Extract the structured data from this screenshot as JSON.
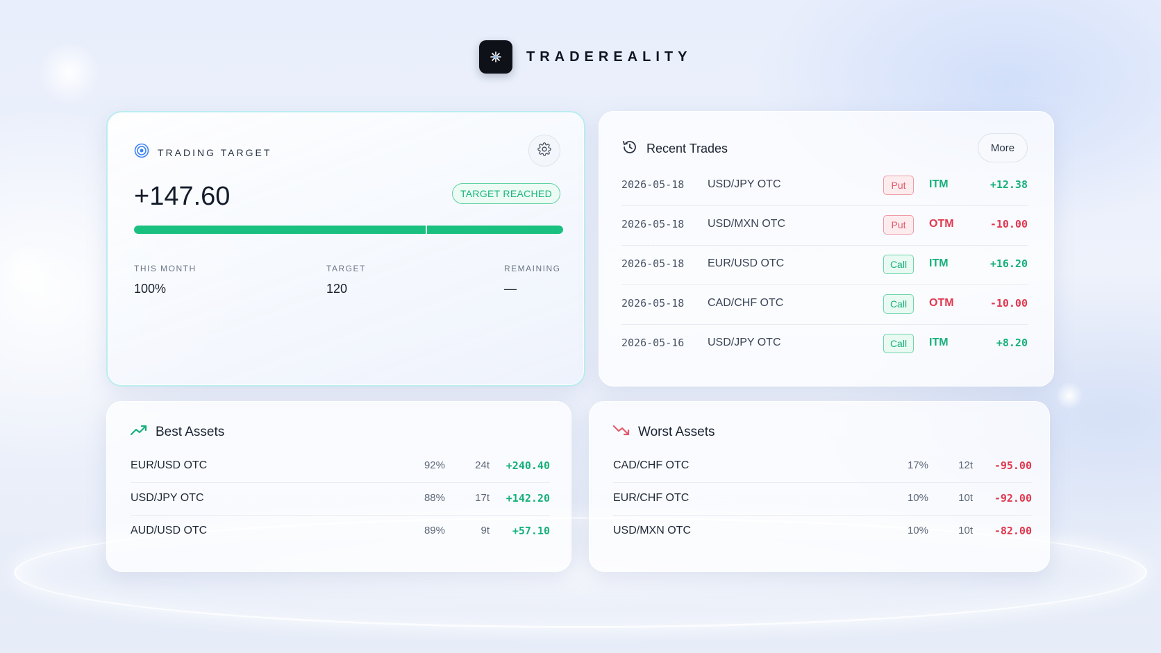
{
  "brand": {
    "name": "TRADEREALITY",
    "logo_icon": "spark-icon"
  },
  "colors": {
    "accent_green": "#19c07f",
    "loss_red": "#e0384f",
    "badge_green": "#19b57a"
  },
  "target": {
    "title": "TRADING TARGET",
    "value": "+147.60",
    "badge": "TARGET REACHED",
    "progress": 1.0,
    "stats": [
      {
        "label": "THIS MONTH",
        "value": "100%"
      },
      {
        "label": "TARGET",
        "value": "120"
      },
      {
        "label": "REMAINING",
        "value": "—"
      }
    ]
  },
  "recent_trades": {
    "title": "Recent Trades",
    "more_label": "More",
    "rows": [
      {
        "date": "2026-05-18",
        "asset": "USD/JPY OTC",
        "direction": "Put",
        "status": "ITM",
        "pl": "+12.38"
      },
      {
        "date": "2026-05-18",
        "asset": "USD/MXN OTC",
        "direction": "Put",
        "status": "OTM",
        "pl": "-10.00"
      },
      {
        "date": "2026-05-18",
        "asset": "EUR/USD OTC",
        "direction": "Call",
        "status": "ITM",
        "pl": "+16.20"
      },
      {
        "date": "2026-05-18",
        "asset": "CAD/CHF OTC",
        "direction": "Call",
        "status": "OTM",
        "pl": "-10.00"
      },
      {
        "date": "2026-05-16",
        "asset": "USD/JPY OTC",
        "direction": "Call",
        "status": "ITM",
        "pl": "+8.20"
      }
    ]
  },
  "best_assets": {
    "title": "Best Assets",
    "rows": [
      {
        "asset": "EUR/USD OTC",
        "rate": "92%",
        "trades": "24t",
        "pl": "+240.40"
      },
      {
        "asset": "USD/JPY OTC",
        "rate": "88%",
        "trades": "17t",
        "pl": "+142.20"
      },
      {
        "asset": "AUD/USD OTC",
        "rate": "89%",
        "trades": "9t",
        "pl": "+57.10"
      }
    ]
  },
  "worst_assets": {
    "title": "Worst Assets",
    "rows": [
      {
        "asset": "CAD/CHF OTC",
        "rate": "17%",
        "trades": "12t",
        "pl": "-95.00"
      },
      {
        "asset": "EUR/CHF OTC",
        "rate": "10%",
        "trades": "10t",
        "pl": "-92.00"
      },
      {
        "asset": "USD/MXN OTC",
        "rate": "10%",
        "trades": "10t",
        "pl": "-82.00"
      }
    ]
  }
}
